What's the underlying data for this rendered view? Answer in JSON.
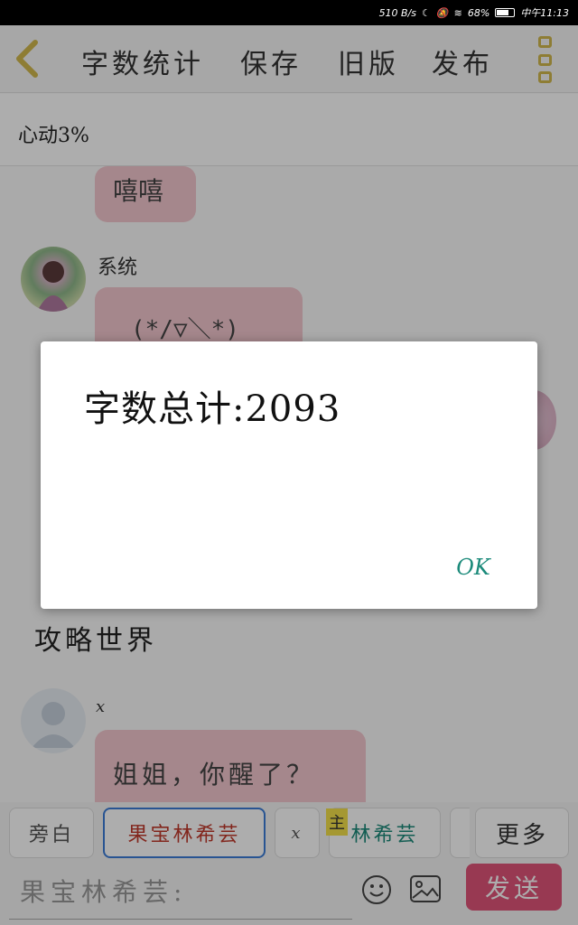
{
  "status_bar": {
    "speed": "510 B/s",
    "battery": "68%",
    "time": "中午11:13"
  },
  "toolbar": {
    "items": [
      "字数统计",
      "保存",
      "旧版",
      "发布"
    ]
  },
  "subheader": {
    "text": "心动3%"
  },
  "chat": {
    "bubble_1": "嘻嘻",
    "speaker_2": "系统",
    "bubble_2": "(*/▽＼*)",
    "section_title": "攻略世界",
    "speaker_3": "x",
    "bubble_3": "姐姐，你醒了？"
  },
  "dialog": {
    "message": "字数总计:2093",
    "ok_label": "OK"
  },
  "chips": {
    "narration": "旁白",
    "character_active": "果宝林希芸",
    "x": "x",
    "main_tag": "主",
    "character_main": "林希芸",
    "more": "更多"
  },
  "input": {
    "value": "果宝林希芸:"
  },
  "send_label": "发送",
  "colors": {
    "accent_yellow": "#d2b84d",
    "bubble_pink": "#f3c8cf",
    "send_pink": "#e0557a",
    "ok_teal": "#1b8a7a",
    "active_chip_red": "#c0392b",
    "active_chip_border": "#3b7dd8"
  }
}
